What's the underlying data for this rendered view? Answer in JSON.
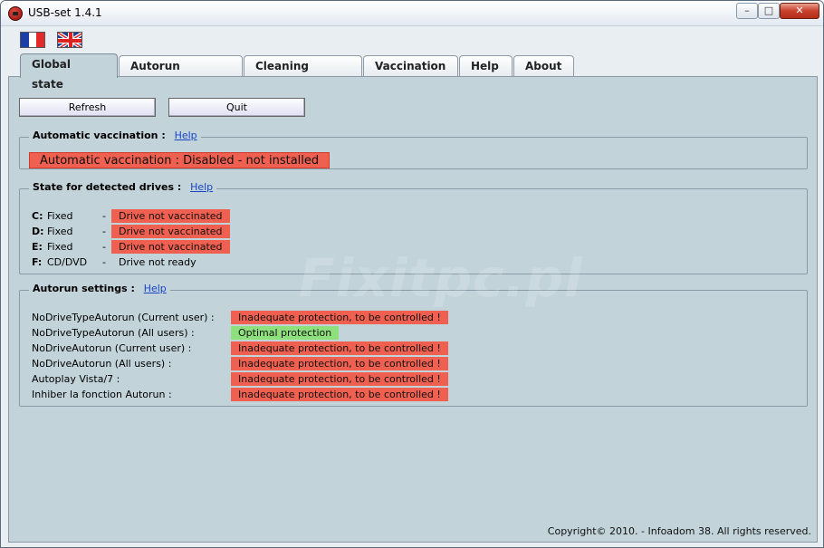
{
  "window": {
    "title": "USB-set 1.4.1",
    "minimize": "–",
    "maximize": "□",
    "close": "✕"
  },
  "languages": [
    {
      "name": "flag-fr-icon"
    },
    {
      "name": "flag-uk-icon"
    }
  ],
  "tabs": [
    {
      "label": "Global state",
      "active": true
    },
    {
      "label": "Autorun settings"
    },
    {
      "label": "Cleaning traces"
    },
    {
      "label": "Vaccination"
    },
    {
      "label": "Help"
    },
    {
      "label": "About"
    }
  ],
  "buttons": {
    "refresh": "Refresh",
    "quit": "Quit"
  },
  "auto_vaccination": {
    "title": "Automatic vaccination :",
    "help": "Help",
    "status": "Automatic vaccination : Disabled - not installed"
  },
  "drives": {
    "title": "State for detected drives :",
    "help": "Help",
    "items": [
      {
        "letter": "C:",
        "type": "Fixed",
        "dash": "-",
        "state": "Drive not vaccinated",
        "status": "bad"
      },
      {
        "letter": "D:",
        "type": "Fixed",
        "dash": "-",
        "state": "Drive not vaccinated",
        "status": "bad"
      },
      {
        "letter": "E:",
        "type": "Fixed",
        "dash": "-",
        "state": "Drive not vaccinated",
        "status": "bad"
      },
      {
        "letter": "F:",
        "type": "CD/DVD",
        "dash": "-",
        "state": "Drive not ready",
        "status": "neutral"
      }
    ]
  },
  "autorun": {
    "title": "Autorun settings :",
    "help": "Help",
    "items": [
      {
        "label": "NoDriveTypeAutorun (Current user) :",
        "state": "Inadequate protection, to be controlled !",
        "status": "bad"
      },
      {
        "label": "NoDriveTypeAutorun (All users) :",
        "state": "Optimal protection",
        "status": "good"
      },
      {
        "label": "NoDriveAutorun (Current user) :",
        "state": "Inadequate protection, to be controlled !",
        "status": "bad"
      },
      {
        "label": "NoDriveAutorun (All users) :",
        "state": "Inadequate protection, to be controlled !",
        "status": "bad"
      },
      {
        "label": "Autoplay Vista/7 :",
        "state": "Inadequate protection, to be controlled !",
        "status": "bad"
      },
      {
        "label": "Inhiber la fonction Autorun :",
        "state": "Inadequate protection, to be controlled !",
        "status": "bad"
      }
    ]
  },
  "watermark": "Fixitpc.pl",
  "copyright": "Copyright© 2010. - Infoadom 38. All rights reserved.",
  "colors": {
    "bad": "#f06050",
    "good": "#8ee07c",
    "panel": "#c2d3da"
  }
}
